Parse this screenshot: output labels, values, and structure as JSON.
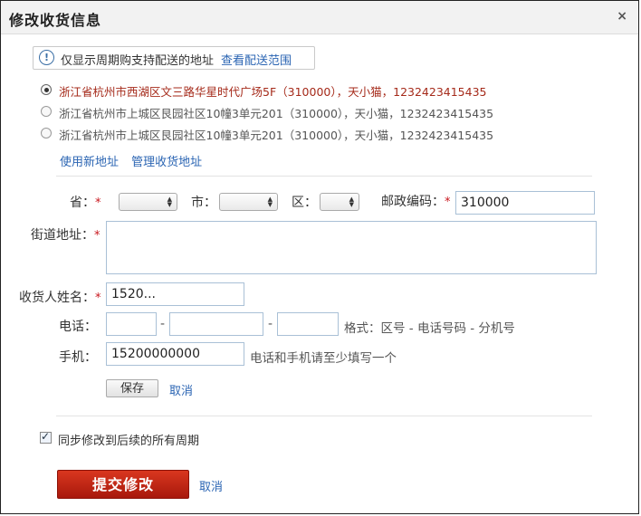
{
  "dialog": {
    "title": "修改收货信息",
    "close_symbol": "×"
  },
  "notice": {
    "icon": "info-icon",
    "icon_symbol": "!",
    "text": "仅显示周期购支持配送的地址",
    "link": "查看配送范围"
  },
  "addresses": [
    {
      "text": "浙江省杭州市西湖区文三路华星时代广场5F（310000），天小猫，1232423415435",
      "selected": true
    },
    {
      "text": "浙江省杭州市上城区艮园社区10幢3单元201（310000），天小猫，1232423415435",
      "selected": false
    },
    {
      "text": "浙江省杭州市上城区艮园社区10幢3单元201（310000），天小猫，1232423415435",
      "selected": false
    }
  ],
  "address_links": {
    "new": "使用新地址",
    "manage": "管理收货地址"
  },
  "form": {
    "required_mark": "*",
    "province_label": "省：",
    "city_label": "市：",
    "district_label": "区：",
    "zip_label": "邮政编码：",
    "zip_value": "310000",
    "street_label": "街道地址：",
    "street_value": "",
    "name_label": "收货人姓名：",
    "name_value": "1520...",
    "phone_label": "电话：",
    "phone_sep": "-",
    "phone_hint": "格式：区号 - 电话号码 - 分机号",
    "mobile_label": "手机：",
    "mobile_value": "15200000000",
    "mobile_hint": "电话和手机请至少填写一个",
    "save_label": "保存",
    "cancel_label": "取消"
  },
  "sync": {
    "checked": true,
    "label": "同步修改到后续的所有周期"
  },
  "footer": {
    "submit_label": "提交修改",
    "cancel_label": "取消"
  },
  "colors": {
    "accent_link": "#2b65b3",
    "selected_address": "#a52a1a",
    "submit_button": "#c0281a",
    "required": "#c8161d"
  }
}
